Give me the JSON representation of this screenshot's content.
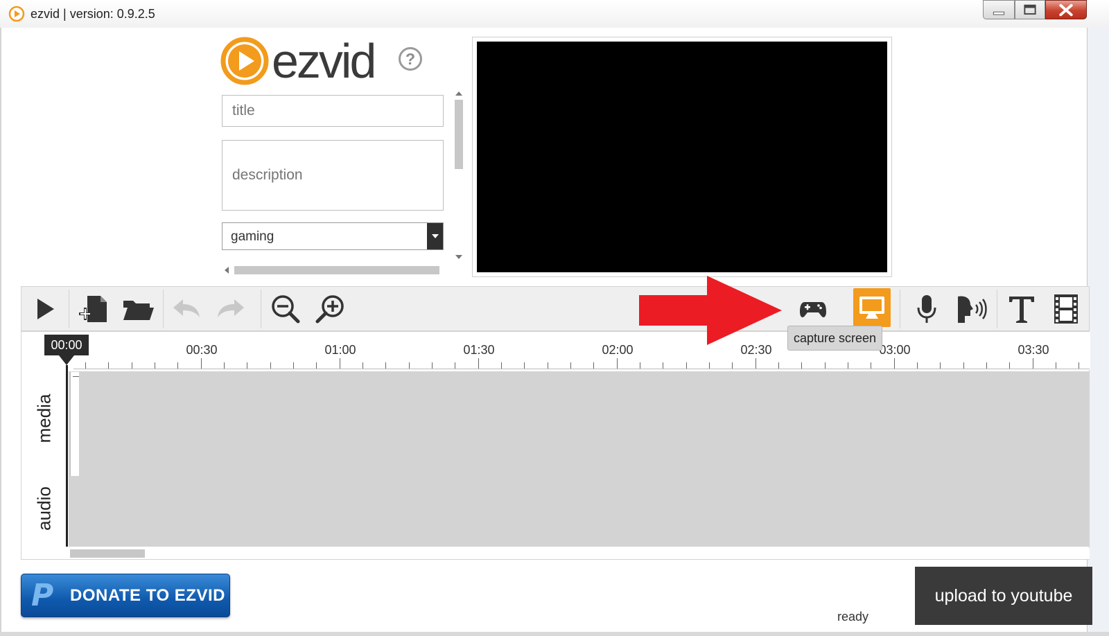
{
  "window": {
    "title": "ezvid | version: 0.9.2.5"
  },
  "brand": {
    "logo_text": "ezvid",
    "accent_color": "#f29b1c"
  },
  "form": {
    "title_placeholder": "title",
    "description_placeholder": "description",
    "category_value": "gaming"
  },
  "toolbar": {
    "buttons": [
      "play-icon",
      "new-project-icon",
      "open-folder-icon",
      "undo-icon",
      "redo-icon",
      "zoom-out-icon",
      "zoom-in-icon",
      "gamepad-icon",
      "capture-screen-icon",
      "microphone-icon",
      "speech-icon",
      "text-icon",
      "film-icon"
    ],
    "active_button": "capture-screen-icon",
    "tooltip": "capture screen"
  },
  "timeline": {
    "playhead": "00:00",
    "ticks": [
      "00:30",
      "01:00",
      "01:30",
      "02:00",
      "02:30",
      "03:00",
      "03:30"
    ],
    "tracks": [
      "media",
      "audio"
    ]
  },
  "footer": {
    "donate_label": "DONATE TO EZVID",
    "status": "ready",
    "upload_label": "upload to youtube"
  }
}
